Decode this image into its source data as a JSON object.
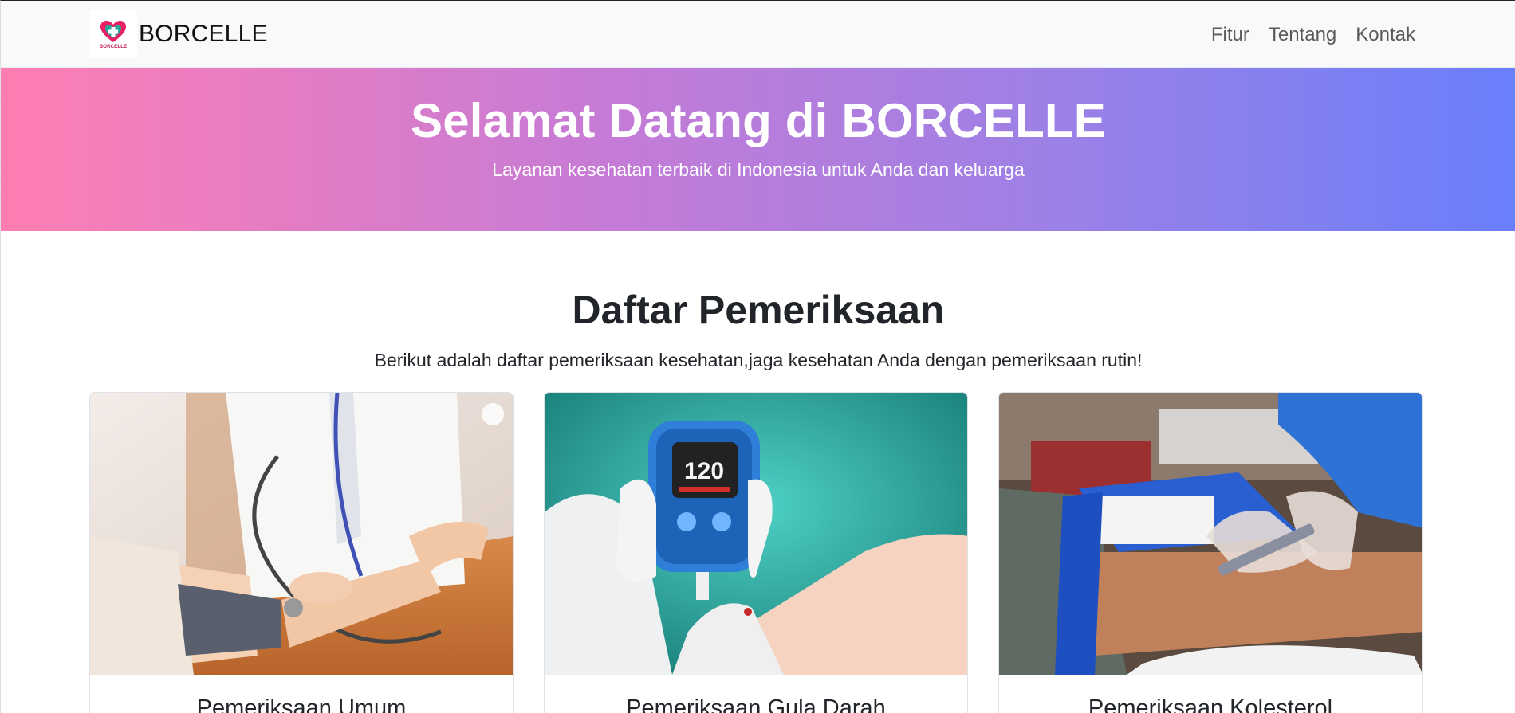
{
  "navbar": {
    "brand_name": "BORCELLE",
    "logo_text": "BORCELLE",
    "links": [
      "Fitur",
      "Tentang",
      "Kontak"
    ]
  },
  "hero": {
    "title": "Selamat Datang di BORCELLE",
    "subtitle": "Layanan kesehatan terbaik di Indonesia untuk Anda dan keluarga"
  },
  "section": {
    "title": "Daftar Pemeriksaan",
    "subtitle": "Berikut adalah daftar pemeriksaan kesehatan,jaga kesehatan Anda dengan pemeriksaan rutin!"
  },
  "cards": [
    {
      "title": "Pemeriksaan Umum"
    },
    {
      "title": "Pemeriksaan Gula Darah",
      "meter_reading": "120"
    },
    {
      "title": "Pemeriksaan Kolesterol"
    }
  ],
  "colors": {
    "gradient_start": "#ff7eb3",
    "gradient_end": "#6a7ffb",
    "logo_pink": "#c2185b"
  }
}
